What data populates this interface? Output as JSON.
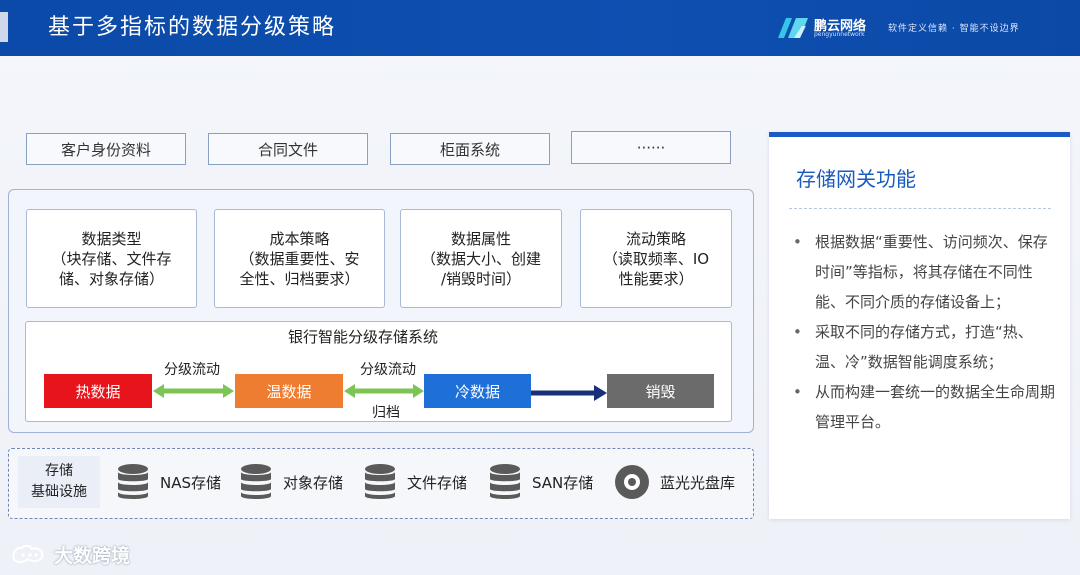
{
  "header": {
    "title": "基于多指标的数据分级策略",
    "brand_name": "鹏云网络",
    "brand_sub": "pengyunnetwork",
    "slogan": "软件定义信赖 · 智能不设边界",
    "color": "#0e4fb0"
  },
  "data_sources": [
    "客户身份资料",
    "合同文件",
    "柜面系统",
    "······"
  ],
  "strategies": [
    {
      "text": "数据类型\n（块存储、文件存\n储、对象存储）"
    },
    {
      "text": "成本策略\n（数据重要性、安\n全性、归档要求）"
    },
    {
      "text": "数据属性\n（数据大小、创建\n/销毁时间）"
    },
    {
      "text": "流动策略\n（读取频率、IO\n性能要求）"
    }
  ],
  "system": {
    "title": "银行智能分级存储系统",
    "tiers": [
      {
        "label": "热数据",
        "color": "#e8141b"
      },
      {
        "label": "温数据",
        "color": "#ef7d31"
      },
      {
        "label": "冷数据",
        "color": "#1f6fd8"
      },
      {
        "label": "销毁",
        "color": "#6b6b6b"
      }
    ],
    "flow_labels": {
      "hot_warm": "分级流动",
      "warm_cold": "分级流动",
      "archive": "归档"
    }
  },
  "infrastructure": {
    "label": "存储\n基础设施",
    "items": [
      {
        "label": "NAS存储",
        "icon": "database-icon"
      },
      {
        "label": "对象存储",
        "icon": "database-icon"
      },
      {
        "label": "文件存储",
        "icon": "database-icon"
      },
      {
        "label": "SAN存储",
        "icon": "database-icon"
      },
      {
        "label": "蓝光光盘库",
        "icon": "disc-icon"
      }
    ]
  },
  "side_panel": {
    "title": "存储网关功能",
    "bullets": [
      "根据数据“重要性、访问频次、保存时间”等指标，将其存储在不同性能、不同介质的存储设备上；",
      "采取不同的存储方式，打造“热、温、冷”数据智能调度系统；",
      "从而构建一套统一的数据全生命周期管理平台。"
    ]
  },
  "watermark": "大数跨境"
}
